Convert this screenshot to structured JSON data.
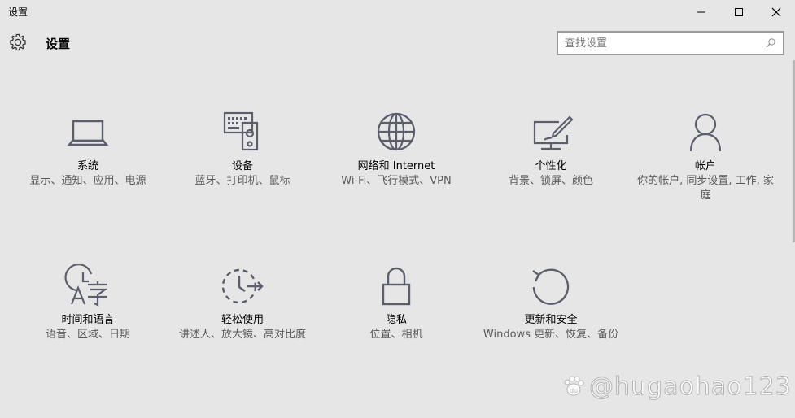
{
  "window": {
    "title": "设置"
  },
  "header": {
    "title": "设置"
  },
  "search": {
    "placeholder": "查找设置"
  },
  "tiles": [
    {
      "title": "系统",
      "desc": "显示、通知、应用、电源",
      "icon": "laptop-icon"
    },
    {
      "title": "设备",
      "desc": "蓝牙、打印机、鼠标",
      "icon": "keyboard-speaker-icon"
    },
    {
      "title": "网络和 Internet",
      "desc": "Wi-Fi、飞行模式、VPN",
      "icon": "globe-icon"
    },
    {
      "title": "个性化",
      "desc": "背景、锁屏、颜色",
      "icon": "paint-monitor-icon"
    },
    {
      "title": "帐户",
      "desc": "你的帐户, 同步设置, 工作, 家庭",
      "icon": "person-icon"
    },
    {
      "title": "时间和语言",
      "desc": "语音、区域、日期",
      "icon": "clock-language-icon"
    },
    {
      "title": "轻松使用",
      "desc": "讲述人、放大镜、高对比度",
      "icon": "ease-of-access-icon"
    },
    {
      "title": "隐私",
      "desc": "位置、相机",
      "icon": "lock-icon"
    },
    {
      "title": "更新和安全",
      "desc": "Windows 更新、恢复、备份",
      "icon": "refresh-icon"
    }
  ],
  "watermark": {
    "text": "@hugaohao123"
  },
  "colors": {
    "background": "#e6e6e6",
    "icon": "#5b5f6b",
    "desc": "#5a5a5a"
  }
}
